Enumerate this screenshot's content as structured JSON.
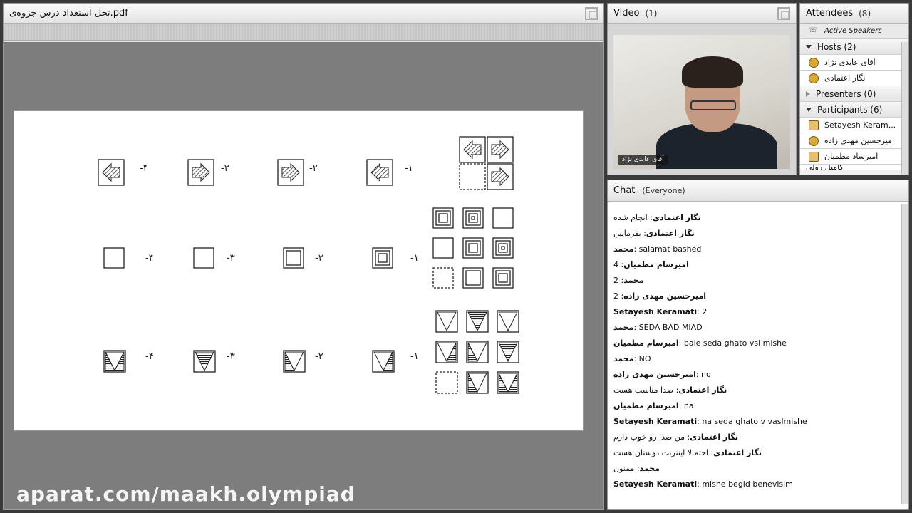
{
  "doc": {
    "title": "تحل استعداد درس جزوه‌ی.pdf"
  },
  "watermark": "aparat.com/maakh.olympiad",
  "video": {
    "title": "Video",
    "count": "(1)",
    "presenter_name": "آقای عابدی نژاد"
  },
  "attendees": {
    "title": "Attendees",
    "count": "(8)",
    "active_speakers": "Active Speakers",
    "groups": [
      {
        "label": "Hosts (2)",
        "expanded": true,
        "members": [
          "آقای عابدی نژاد",
          "نگار اعتمادی"
        ]
      },
      {
        "label": "Presenters (0)",
        "expanded": false,
        "members": []
      },
      {
        "label": "Participants (6)",
        "expanded": true,
        "members": [
          "Setayesh Keram...",
          "امیرحسین مهدی زاده",
          "امیرساد مطمیان",
          "کامیل رولی"
        ]
      }
    ]
  },
  "chat": {
    "title": "Chat",
    "scope": "(Everyone)",
    "messages": [
      {
        "who": "نگار اعتمادی",
        "text": "انجام شده"
      },
      {
        "who": "نگار اعتمادی",
        "text": "بفرمایین"
      },
      {
        "who": "محمد",
        "text": "salamat bashed"
      },
      {
        "who": "امیرسام مطمیان",
        "text": "4"
      },
      {
        "who": "محمد",
        "text": "2"
      },
      {
        "who": "امیرحسین مهدی زاده",
        "text": "2"
      },
      {
        "who": "Setayesh Keramati",
        "text": "2"
      },
      {
        "who": "محمد",
        "text": "SEDA BAD MIAD"
      },
      {
        "who": "امیرسام مطمیان",
        "text": "bale seda ghato vsl mishe"
      },
      {
        "who": "محمد",
        "text": "NO"
      },
      {
        "who": "امیرحسین مهدی زاده",
        "text": "no"
      },
      {
        "who": "نگار اعتمادی",
        "text": "صدا مناسب هست"
      },
      {
        "who": "امیرسام مطمیان",
        "text": "na"
      },
      {
        "who": "Setayesh Keramati",
        "text": "na seda ghato v vaslmishe"
      },
      {
        "who": "نگار اعتمادی",
        "text": "من صدا رو خوب دارم"
      },
      {
        "who": "نگار اعتمادی",
        "text": "احتمالا اینترنت دوستان هست"
      },
      {
        "who": "محمد",
        "text": "ممنون"
      },
      {
        "who": "Setayesh Keramati",
        "text": "mishe begid benevisim"
      }
    ]
  },
  "figure": {
    "row_labels": [
      "-۴",
      "-۳",
      "-۲",
      "-۱"
    ]
  }
}
